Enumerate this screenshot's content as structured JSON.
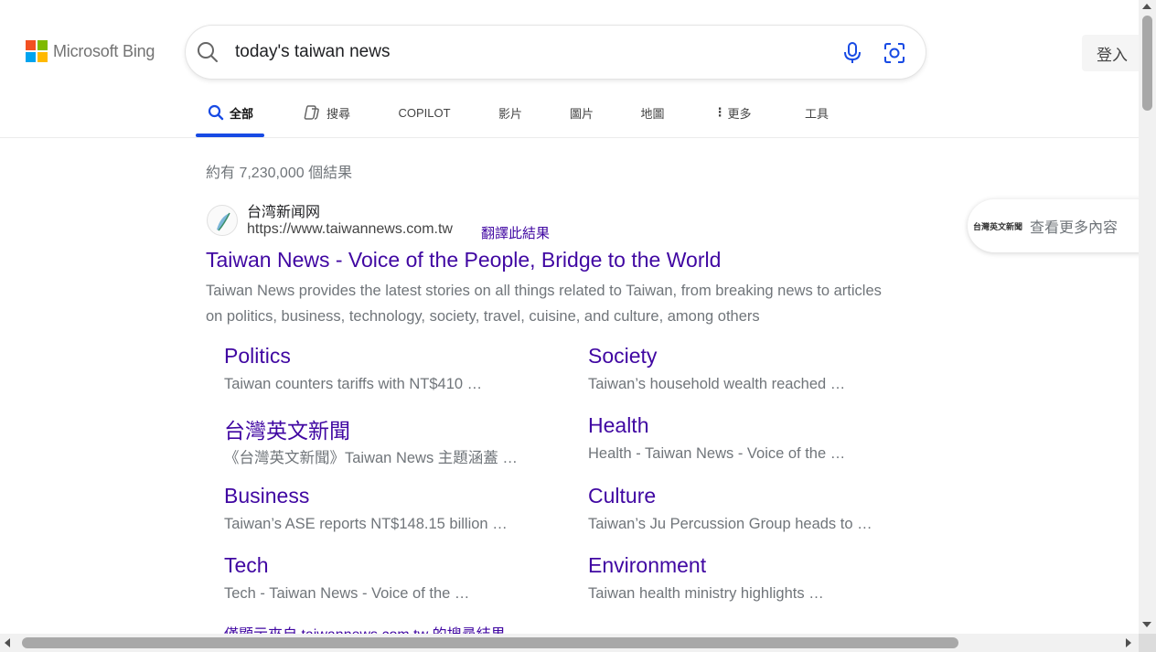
{
  "logo": {
    "text": "Microsoft Bing",
    "colors": [
      "#f25022",
      "#7fba00",
      "#00a4ef",
      "#ffb900"
    ]
  },
  "search": {
    "query": "today's taiwan news",
    "icon": "search-icon",
    "mic_icon": "microphone-icon",
    "visual_icon": "visual-search-icon"
  },
  "header": {
    "signin_label": "登入"
  },
  "tabs": [
    {
      "label": "全部",
      "icon": "search-icon",
      "active": true
    },
    {
      "label": "搜尋",
      "icon": "copilot-icon"
    },
    {
      "label": "COPILOT"
    },
    {
      "label": "影片"
    },
    {
      "label": "圖片"
    },
    {
      "label": "地圖"
    },
    {
      "label": "更多",
      "icon": "more-vertical-icon"
    },
    {
      "label": "工具"
    }
  ],
  "results": {
    "count_text": "約有 7,230,000 個結果",
    "site_name": "台湾新闻网",
    "site_url": "https://www.taiwannews.com.tw",
    "translate_label": "翻譯此結果",
    "title": "Taiwan News - Voice of the People, Bridge to the World",
    "snippet": "Taiwan News provides the latest stories on all things related to Taiwan, from breaking news to articles on politics, business, technology, society, travel, cuisine, and culture, among others",
    "deeplinks": [
      {
        "title": "Politics",
        "snippet": "Taiwan counters tariffs with NT$410 …"
      },
      {
        "title": "台灣英文新聞",
        "snippet": "《台灣英文新聞》Taiwan News 主題涵蓋 …"
      },
      {
        "title": "Business",
        "snippet": "Taiwan’s ASE reports NT$148.15 billion …"
      },
      {
        "title": "Tech",
        "snippet": "Tech - Taiwan News - Voice of the …"
      },
      {
        "title": "Society",
        "snippet": "Taiwan’s household wealth reached …"
      },
      {
        "title": "Health",
        "snippet": "Health - Taiwan News - Voice of the …"
      },
      {
        "title": "Culture",
        "snippet": "Taiwan’s Ju Percussion Group heads to …"
      },
      {
        "title": "Environment",
        "snippet": "Taiwan health ministry highlights …"
      }
    ],
    "footer_link": "僅顯示來自 taiwannews.com.tw 的搜尋結果"
  },
  "side_card": {
    "logo_text": "台灣英文新聞",
    "label": "查看更多內容"
  },
  "colors": {
    "link": "#4007a2",
    "accent": "#174ae4",
    "muted": "#70757a"
  }
}
